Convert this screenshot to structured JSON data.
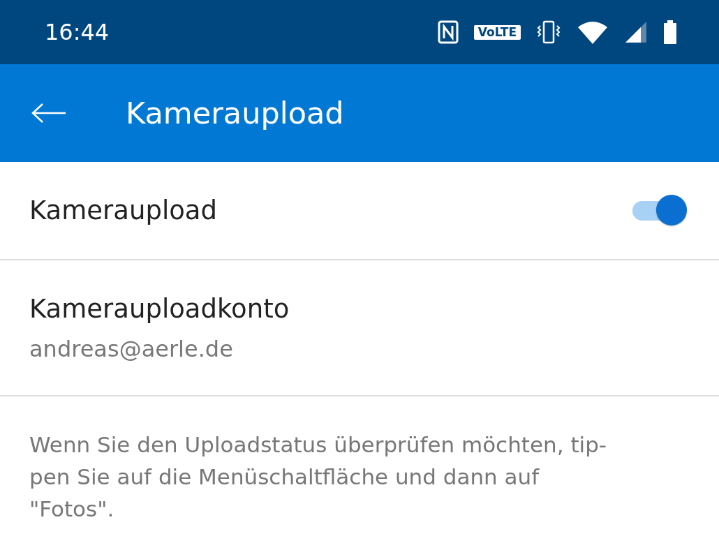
{
  "status_bar": {
    "time": "16:44",
    "volte": "VoLTE"
  },
  "app_bar": {
    "title": "Kameraupload"
  },
  "settings": [
    {
      "kind": "toggle",
      "label": "Kameraupload",
      "on": true
    },
    {
      "kind": "account",
      "label": "Kamerauploadkonto",
      "value": "andreas@aerle.de"
    }
  ],
  "note_lines": [
    "Wenn Sie den Uploadstatus überprüfen möchten, tip-",
    "pen Sie auf die Menüschaltfläche und dann auf",
    "\"Fotos\"."
  ]
}
